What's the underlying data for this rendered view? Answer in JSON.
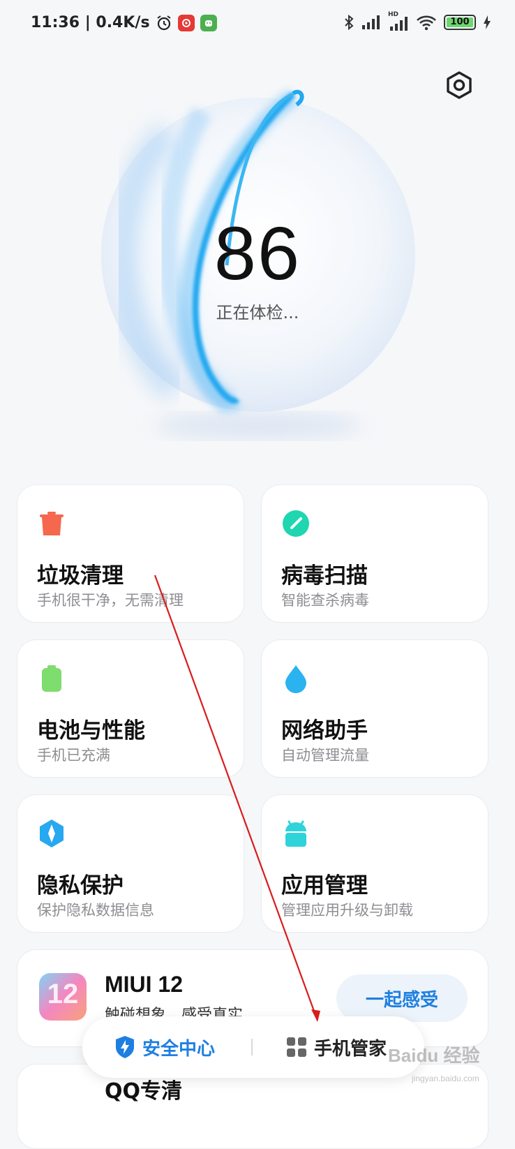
{
  "status_bar": {
    "time_speed": "11:36 | 0.4K/s",
    "hd_label": "HD",
    "battery": "100"
  },
  "score": {
    "value": "86",
    "status": "正在体检..."
  },
  "cards": [
    {
      "title": "垃圾清理",
      "subtitle": "手机很干净，无需清理",
      "icon": "trash-icon",
      "color": "#f5684e"
    },
    {
      "title": "病毒扫描",
      "subtitle": "智能查杀病毒",
      "icon": "virus-scan-icon",
      "color": "#1ed6b0"
    },
    {
      "title": "电池与性能",
      "subtitle": "手机已充满",
      "icon": "battery-icon",
      "color": "#7fdc6e"
    },
    {
      "title": "网络助手",
      "subtitle": "自动管理流量",
      "icon": "water-drop-icon",
      "color": "#2bb3f0"
    },
    {
      "title": "隐私保护",
      "subtitle": "保护隐私数据信息",
      "icon": "privacy-shield-icon",
      "color": "#27a8f0"
    },
    {
      "title": "应用管理",
      "subtitle": "管理应用升级与卸载",
      "icon": "android-app-icon",
      "color": "#2fd3d9"
    }
  ],
  "promo": {
    "title": "MIUI 12",
    "subtitle": "触碰想象，感受真实",
    "button": "一起感受",
    "logo_text": "12"
  },
  "next_card": {
    "title": "QQ专清"
  },
  "tabs": {
    "security": "安全中心",
    "manager": "手机管家"
  },
  "watermark": {
    "text": "Baidu 经验",
    "sub": "jingyan.baidu.com"
  },
  "colors": {
    "accent_blue": "#1e7fe0",
    "annotation_red": "#d91c1c"
  }
}
